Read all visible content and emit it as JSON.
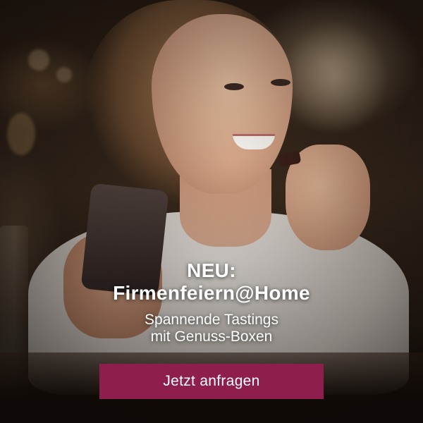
{
  "promo": {
    "headline_line1": "NEU:",
    "headline_line2": "Firmenfeiern@Home",
    "subline_line1": "Spannende Tastings",
    "subline_line2": "mit Genuss-Boxen",
    "cta_label": "Jetzt anfragen",
    "cta_color": "#8e1f4d",
    "text_color": "#ffffff"
  }
}
